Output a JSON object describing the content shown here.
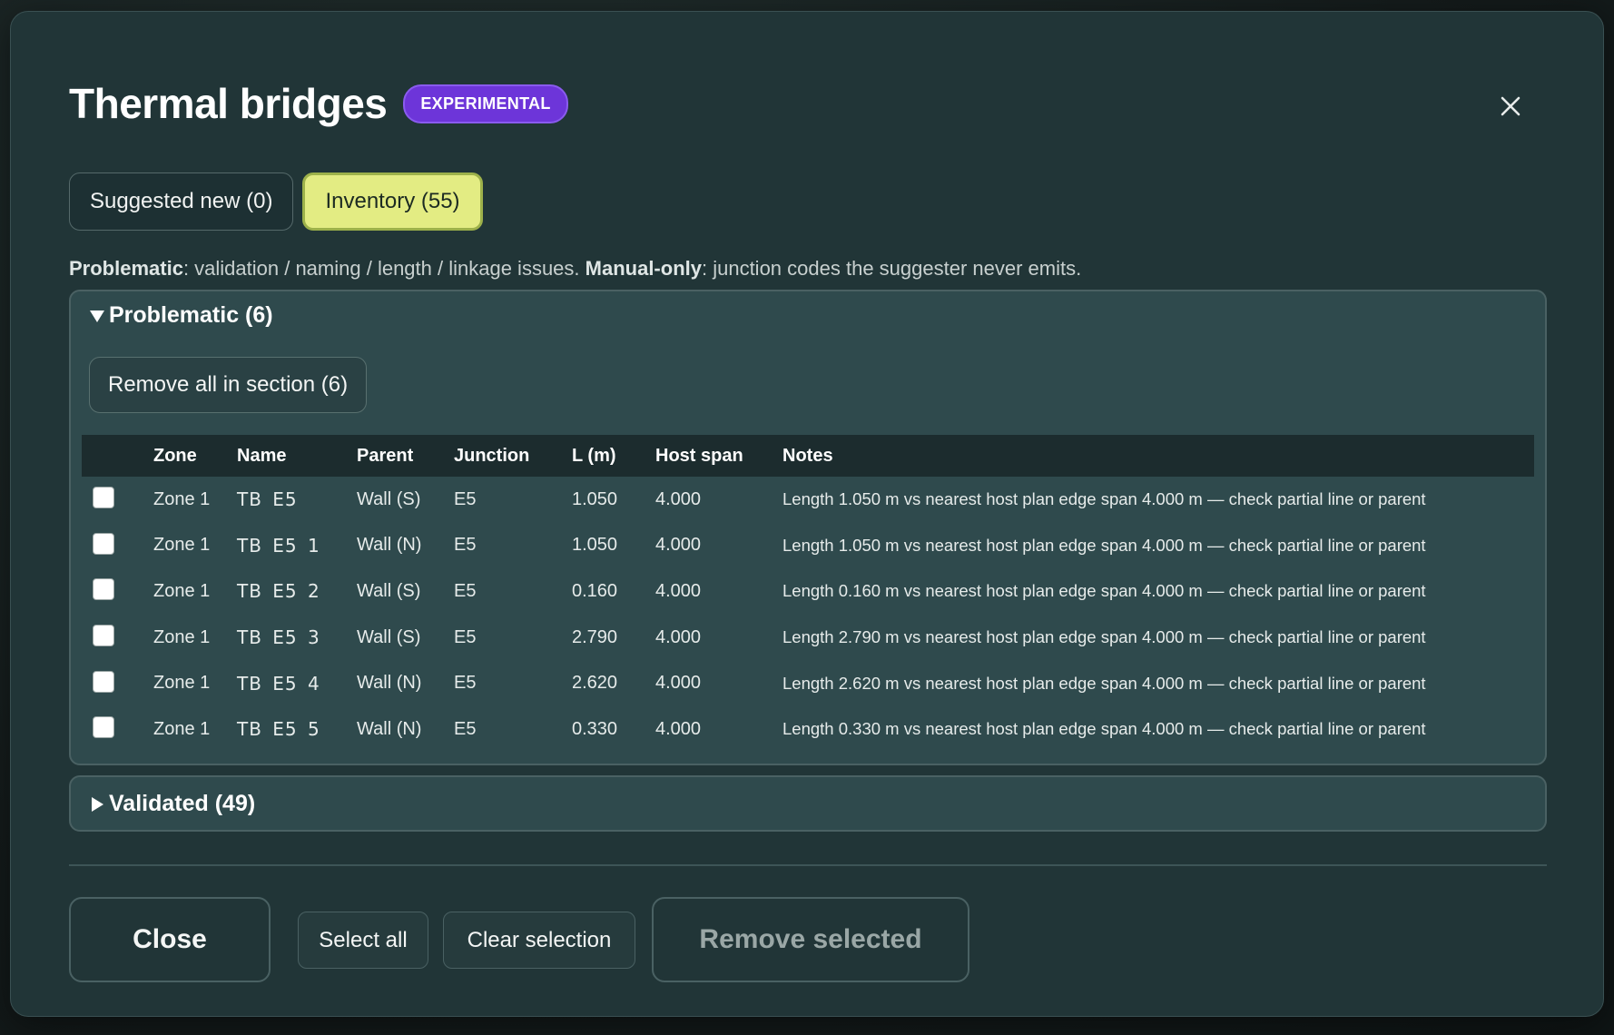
{
  "dialog": {
    "title": "Thermal bridges",
    "badge": "EXPERIMENTAL",
    "close_icon": "close-icon"
  },
  "tabs": [
    {
      "label": "Suggested new (0)",
      "active": false
    },
    {
      "label": "Inventory (55)",
      "active": true
    }
  ],
  "legend": {
    "term1": "Problematic",
    "desc1": ": validation / naming / length / linkage issues. ",
    "term2": "Manual-only",
    "desc2": ": junction codes the suggester never emits."
  },
  "sections": {
    "problematic": {
      "label": "Problematic (6)",
      "expanded": true,
      "remove_all_label": "Remove all in section (6)"
    },
    "validated": {
      "label": "Validated (49)",
      "expanded": false
    }
  },
  "table": {
    "columns": [
      "Zone",
      "Name",
      "Parent",
      "Junction",
      "L (m)",
      "Host span",
      "Notes"
    ],
    "rows": [
      {
        "checked": false,
        "zone": "Zone 1",
        "name": "TB  E5",
        "parent": "Wall (S)",
        "junction": "E5",
        "length": "1.050",
        "host_span": "4.000",
        "notes": "Length 1.050 m vs nearest host plan edge span 4.000 m — check partial line or parent"
      },
      {
        "checked": false,
        "zone": "Zone 1",
        "name": "TB  E5  1",
        "parent": "Wall (N)",
        "junction": "E5",
        "length": "1.050",
        "host_span": "4.000",
        "notes": "Length 1.050 m vs nearest host plan edge span 4.000 m — check partial line or parent"
      },
      {
        "checked": false,
        "zone": "Zone 1",
        "name": "TB  E5  2",
        "parent": "Wall (S)",
        "junction": "E5",
        "length": "0.160",
        "host_span": "4.000",
        "notes": "Length 0.160 m vs nearest host plan edge span 4.000 m — check partial line or parent"
      },
      {
        "checked": false,
        "zone": "Zone 1",
        "name": "TB  E5  3",
        "parent": "Wall (S)",
        "junction": "E5",
        "length": "2.790",
        "host_span": "4.000",
        "notes": "Length 2.790 m vs nearest host plan edge span 4.000 m — check partial line or parent"
      },
      {
        "checked": false,
        "zone": "Zone 1",
        "name": "TB  E5  4",
        "parent": "Wall (N)",
        "junction": "E5",
        "length": "2.620",
        "host_span": "4.000",
        "notes": "Length 2.620 m vs nearest host plan edge span 4.000 m — check partial line or parent"
      },
      {
        "checked": false,
        "zone": "Zone 1",
        "name": "TB  E5  5",
        "parent": "Wall (N)",
        "junction": "E5",
        "length": "0.330",
        "host_span": "4.000",
        "notes": "Length 0.330 m vs nearest host plan edge span 4.000 m — check partial line or parent"
      }
    ]
  },
  "footer": {
    "close_label": "Close",
    "select_all_label": "Select all",
    "clear_selection_label": "Clear selection",
    "remove_selected_label": "Remove selected"
  },
  "colors": {
    "badge": "#6d35d9",
    "active_tab": "#e3ec83",
    "panel": "#213537"
  }
}
